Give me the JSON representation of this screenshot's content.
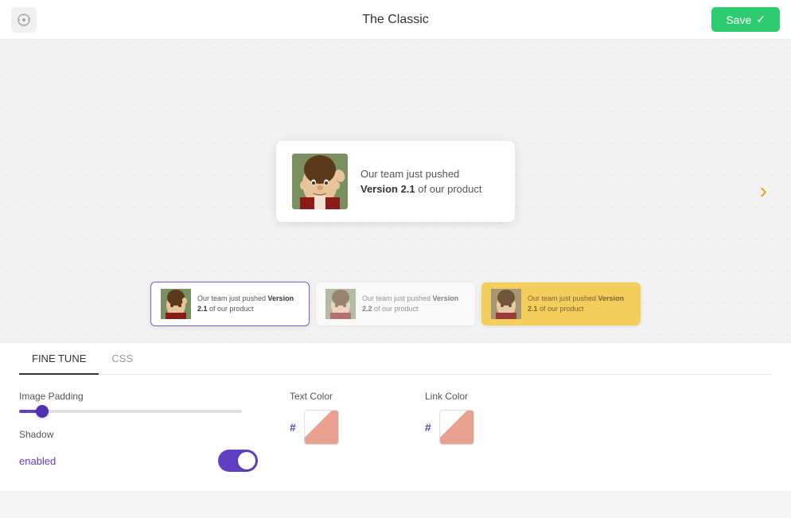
{
  "header": {
    "title": "The Classic",
    "save_label": "Save",
    "logo_icon": "logo-icon"
  },
  "preview": {
    "main_card": {
      "text_before_bold": "Our team just pushed ",
      "text_bold": "Version 2.1",
      "text_after": " of our product"
    },
    "thumbnails": [
      {
        "id": "thumb-1",
        "text_before_bold": "Our team just pushed ",
        "text_bold": "Version 2.1",
        "text_after": " of our product",
        "active": true
      },
      {
        "id": "thumb-2",
        "text_before_bold": "Our team just pushed ",
        "text_bold": "Version 2.2",
        "text_after": " of our product",
        "active": false
      },
      {
        "id": "thumb-3",
        "text_before_bold": "Our team just pushed ",
        "text_bold": "Version 2.1",
        "text_after": " of our product",
        "active": false,
        "golden": true
      }
    ],
    "next_arrow": "›"
  },
  "tabs": [
    {
      "id": "fine-tune",
      "label": "FINE TUNE",
      "active": true
    },
    {
      "id": "css",
      "label": "CSS",
      "active": false
    }
  ],
  "controls": {
    "image_padding": {
      "label": "Image Padding",
      "value": 8,
      "min": 0,
      "max": 100
    },
    "text_color": {
      "label": "Text Color",
      "hash": "#"
    },
    "link_color": {
      "label": "Link Color",
      "hash": "#"
    },
    "shadow": {
      "label": "Shadow",
      "status": "enabled",
      "enabled": true
    }
  }
}
